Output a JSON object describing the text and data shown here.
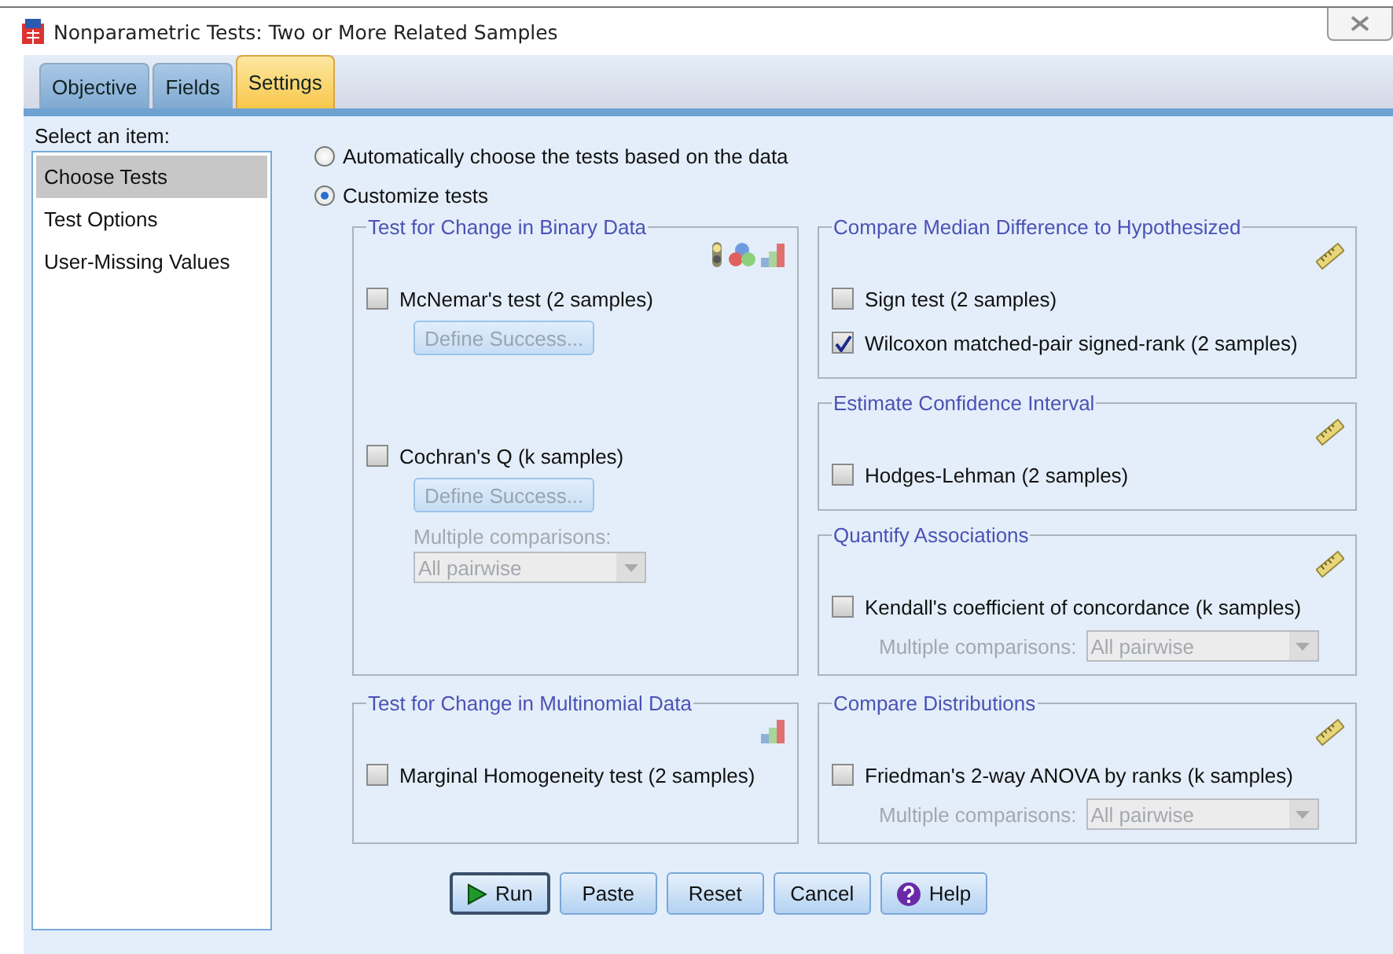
{
  "window": {
    "title": "Nonparametric Tests: Two or More Related Samples"
  },
  "tabs": [
    {
      "label": "Objective",
      "selected": false
    },
    {
      "label": "Fields",
      "selected": false
    },
    {
      "label": "Settings",
      "selected": true
    }
  ],
  "sidebar": {
    "label": "Select an item:",
    "items": [
      {
        "label": "Choose Tests",
        "selected": true
      },
      {
        "label": "Test Options",
        "selected": false
      },
      {
        "label": "User-Missing Values",
        "selected": false
      }
    ]
  },
  "choice": [
    {
      "label": "Automatically choose the tests based on the data",
      "selected": false
    },
    {
      "label": "Customize tests",
      "selected": true
    }
  ],
  "panels": [
    {
      "left": [
        {
          "title": "Test for Change in Binary Data",
          "icons": [
            {
              "kind": "flag"
            },
            {
              "kind": "set"
            },
            {
              "kind": "bars"
            }
          ],
          "items": [
            {
              "kind": "checkbox",
              "label": "McNemar's test (2 samples)",
              "checked": false
            },
            {
              "kind": "button",
              "label": "Define Success...",
              "disabled": true
            },
            {
              "kind": "checkbox",
              "label": "Cochran's Q (k samples)",
              "checked": false
            },
            {
              "kind": "button",
              "label": "Define Success...",
              "disabled": true
            },
            {
              "kind": "dropdown",
              "label": "Multiple comparisons:",
              "value": "All pairwise",
              "disabled": true
            }
          ]
        }
      ],
      "right": [
        {
          "title": "Compare Median Difference to Hypothesized",
          "icons": [
            {
              "kind": "ruler"
            }
          ],
          "items": [
            {
              "kind": "checkbox",
              "label": "Sign test (2 samples)",
              "checked": false
            },
            {
              "kind": "checkbox",
              "label": "Wilcoxon matched-pair signed-rank (2 samples)",
              "checked": true
            }
          ]
        },
        {
          "title": "Estimate Confidence Interval",
          "icons": [
            {
              "kind": "ruler"
            }
          ],
          "items": [
            {
              "kind": "checkbox",
              "label": "Hodges-Lehman (2 samples)",
              "checked": false
            }
          ]
        },
        {
          "title": "Quantify Associations",
          "icons": [
            {
              "kind": "ruler"
            }
          ],
          "items": [
            {
              "kind": "checkbox",
              "label": "Kendall's coefficient of concordance (k samples)",
              "checked": false
            },
            {
              "kind": "inline-dropdown",
              "label": "Multiple comparisons:",
              "value": "All pairwise",
              "disabled": true
            }
          ]
        }
      ]
    },
    {
      "left": [
        {
          "title": "Test for Change in Multinomial Data",
          "icons": [
            {
              "kind": "bars"
            }
          ],
          "items": [
            {
              "kind": "checkbox",
              "label": "Marginal Homogeneity test (2 samples)",
              "checked": false
            }
          ]
        }
      ],
      "right": [
        {
          "title": "Compare Distributions",
          "icons": [
            {
              "kind": "ruler"
            }
          ],
          "items": [
            {
              "kind": "checkbox",
              "label": "Friedman's 2-way ANOVA by ranks (k samples)",
              "checked": false
            },
            {
              "kind": "inline-dropdown",
              "label": "Multiple comparisons:",
              "value": "All pairwise",
              "disabled": true
            }
          ]
        }
      ]
    }
  ],
  "buttons": [
    {
      "label": "Run",
      "kind": "run",
      "default": true
    },
    {
      "label": "Paste",
      "kind": "plain",
      "default": false
    },
    {
      "label": "Reset",
      "kind": "plain",
      "default": false
    },
    {
      "label": "Cancel",
      "kind": "plain",
      "default": false
    },
    {
      "label": "Help",
      "kind": "help",
      "default": false
    }
  ]
}
